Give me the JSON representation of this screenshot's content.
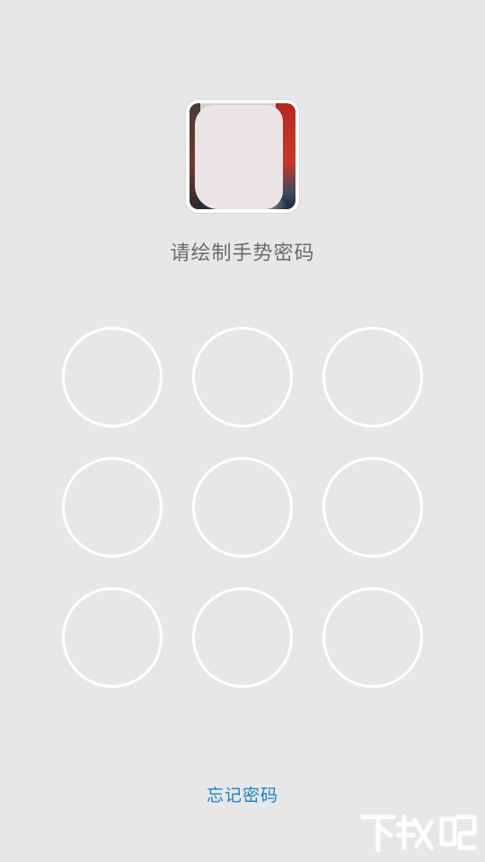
{
  "lock_screen": {
    "prompt": "请绘制手势密码",
    "forgot_password": "忘记密码"
  },
  "pattern": {
    "rows": 3,
    "cols": 3,
    "dot_border_color": "#ffffff"
  },
  "colors": {
    "background": "#e7e7e7",
    "prompt_text": "#6a6a6a",
    "link": "#1c7fc4"
  },
  "watermark": {
    "text": "下载吧"
  }
}
